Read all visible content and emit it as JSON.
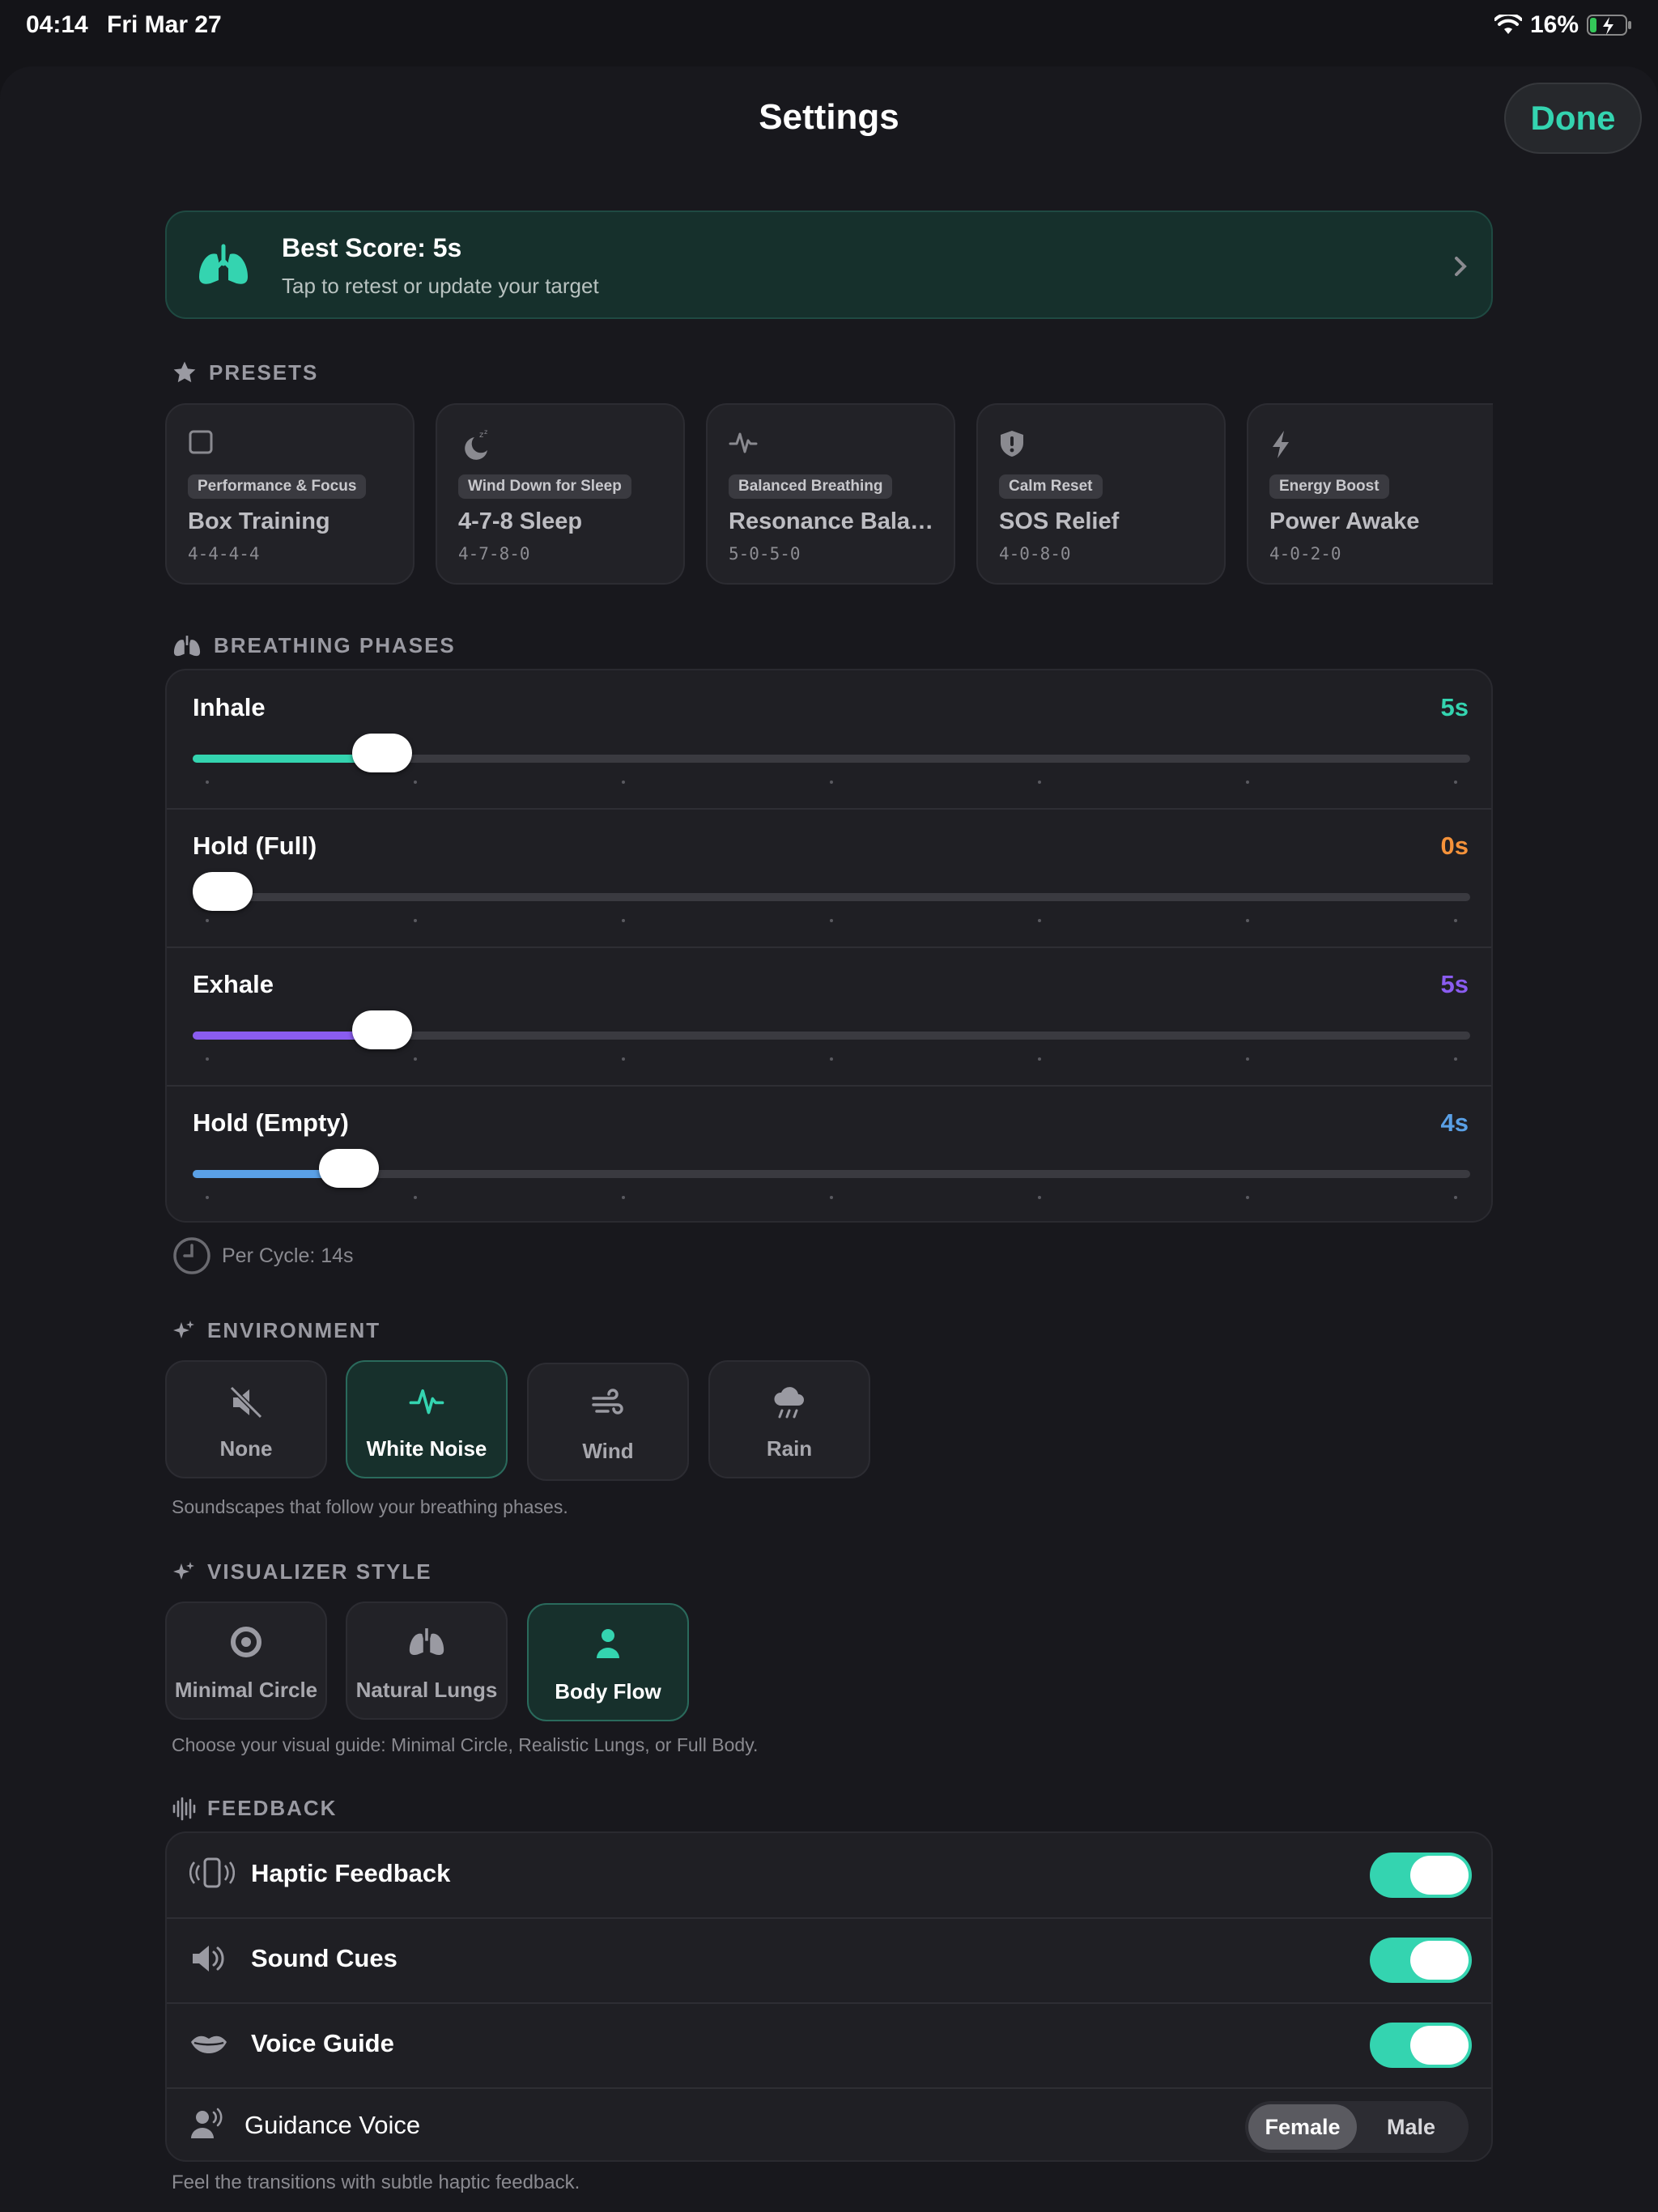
{
  "status_bar": {
    "time": "04:14",
    "date": "Fri Mar 27",
    "battery": "16%"
  },
  "header": {
    "title": "Settings",
    "done_label": "Done"
  },
  "banner": {
    "title": "Best Score: 5s",
    "subtitle": "Tap to retest or update your target",
    "icon": "lungs-icon"
  },
  "presets": {
    "heading": "PRESETS",
    "items": [
      {
        "category": "Performance & Focus",
        "name": "Box Training",
        "pattern": "4-4-4-4",
        "icon": "square-icon"
      },
      {
        "category": "Wind Down for Sleep",
        "name": "4-7-8 Sleep",
        "pattern": "4-7-8-0",
        "icon": "moon-icon"
      },
      {
        "category": "Balanced Breathing",
        "name": "Resonance Bala…",
        "pattern": "5-0-5-0",
        "icon": "waveform-icon"
      },
      {
        "category": "Calm Reset",
        "name": "SOS Relief",
        "pattern": "4-0-8-0",
        "icon": "shield-icon"
      },
      {
        "category": "Energy Boost",
        "name": "Power Awake",
        "pattern": "4-0-2-0",
        "icon": "bolt-icon"
      }
    ]
  },
  "breathing_phases": {
    "heading": "BREATHING PHASES",
    "phases": [
      {
        "label": "Inhale",
        "value": "5s",
        "seconds": 5,
        "color": "#34d4b0"
      },
      {
        "label": "Hold (Full)",
        "value": "0s",
        "seconds": 0,
        "color": "#f5923a"
      },
      {
        "label": "Exhale",
        "value": "5s",
        "seconds": 5,
        "color": "#8a5cf0"
      },
      {
        "label": "Hold (Empty)",
        "value": "4s",
        "seconds": 4,
        "color": "#5aa0e6"
      }
    ],
    "per_cycle": "Per Cycle: 14s"
  },
  "environment": {
    "heading": "ENVIRONMENT",
    "options": [
      {
        "label": "None",
        "icon": "speaker-muted-icon",
        "selected": false
      },
      {
        "label": "White Noise",
        "icon": "waveform-icon",
        "selected": true
      },
      {
        "label": "Wind",
        "icon": "wind-icon",
        "selected": false
      },
      {
        "label": "Rain",
        "icon": "cloud-rain-icon",
        "selected": false
      }
    ],
    "hint": "Soundscapes that follow your breathing phases."
  },
  "visualizer": {
    "heading": "VISUALIZER STYLE",
    "options": [
      {
        "label": "Minimal Circle",
        "icon": "circle-icon",
        "selected": false
      },
      {
        "label": "Natural Lungs",
        "icon": "lungs-icon",
        "selected": false
      },
      {
        "label": "Body Flow",
        "icon": "person-icon",
        "selected": true
      }
    ],
    "hint": "Choose your visual guide: Minimal Circle, Realistic Lungs, or Full Body."
  },
  "feedback": {
    "heading": "FEEDBACK",
    "haptic_label": "Haptic Feedback",
    "sound_label": "Sound Cues",
    "voice_label": "Voice Guide",
    "guidance_label": "Guidance Voice",
    "voice_female": "Female",
    "voice_male": "Male",
    "haptic_on": true,
    "sound_on": true,
    "voice_on": true,
    "hint": "Feel the transitions with subtle haptic feedback."
  },
  "accent_color": "#34d4b0"
}
